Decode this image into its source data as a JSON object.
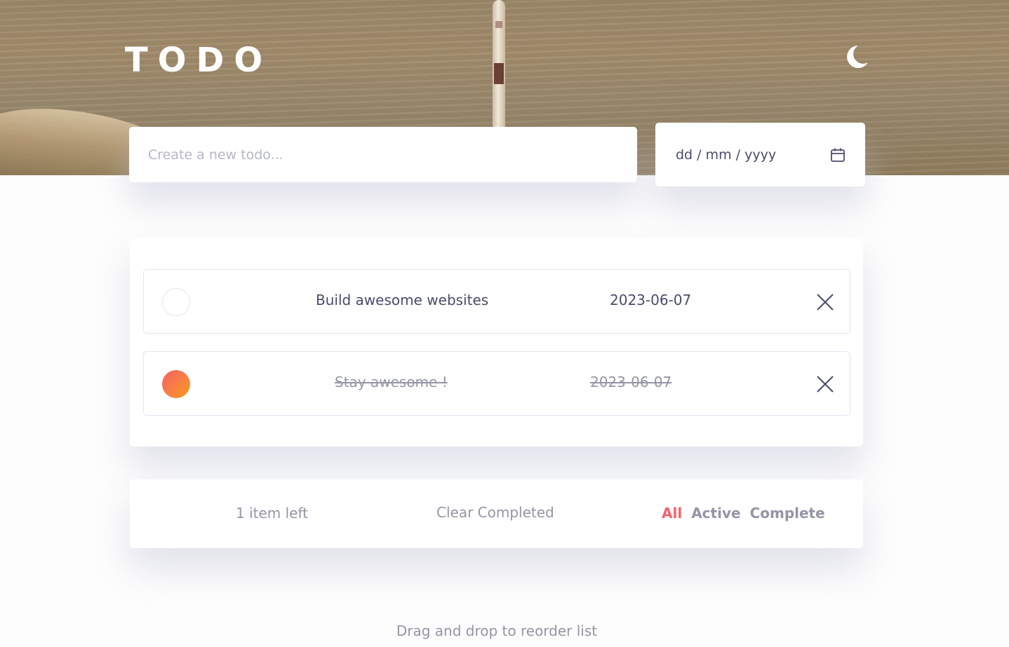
{
  "header": {
    "title": "TODO",
    "theme_icon": "moon-icon"
  },
  "new_todo": {
    "placeholder": "Create a new todo..."
  },
  "date_picker": {
    "value": "dd / mm / yyyy",
    "icon": "calendar-icon"
  },
  "todos": [
    {
      "text": "Build awesome websites",
      "date": "2023-06-07",
      "completed": false
    },
    {
      "text": "Stay awesome !",
      "date": "2023-06-07",
      "completed": true
    }
  ],
  "footer": {
    "items_left": "1 item left",
    "clear_completed": "Clear Completed",
    "filters": [
      {
        "label": "All",
        "active": true
      },
      {
        "label": "Active",
        "active": false
      },
      {
        "label": "Complete",
        "active": false
      }
    ]
  },
  "hint": "Drag and drop to reorder list",
  "colors": {
    "accent": "#f5616a",
    "check_gradient_start": "#f5616a",
    "check_gradient_end": "#f99a1c",
    "text": "#494c6b",
    "muted": "#9495a5"
  }
}
